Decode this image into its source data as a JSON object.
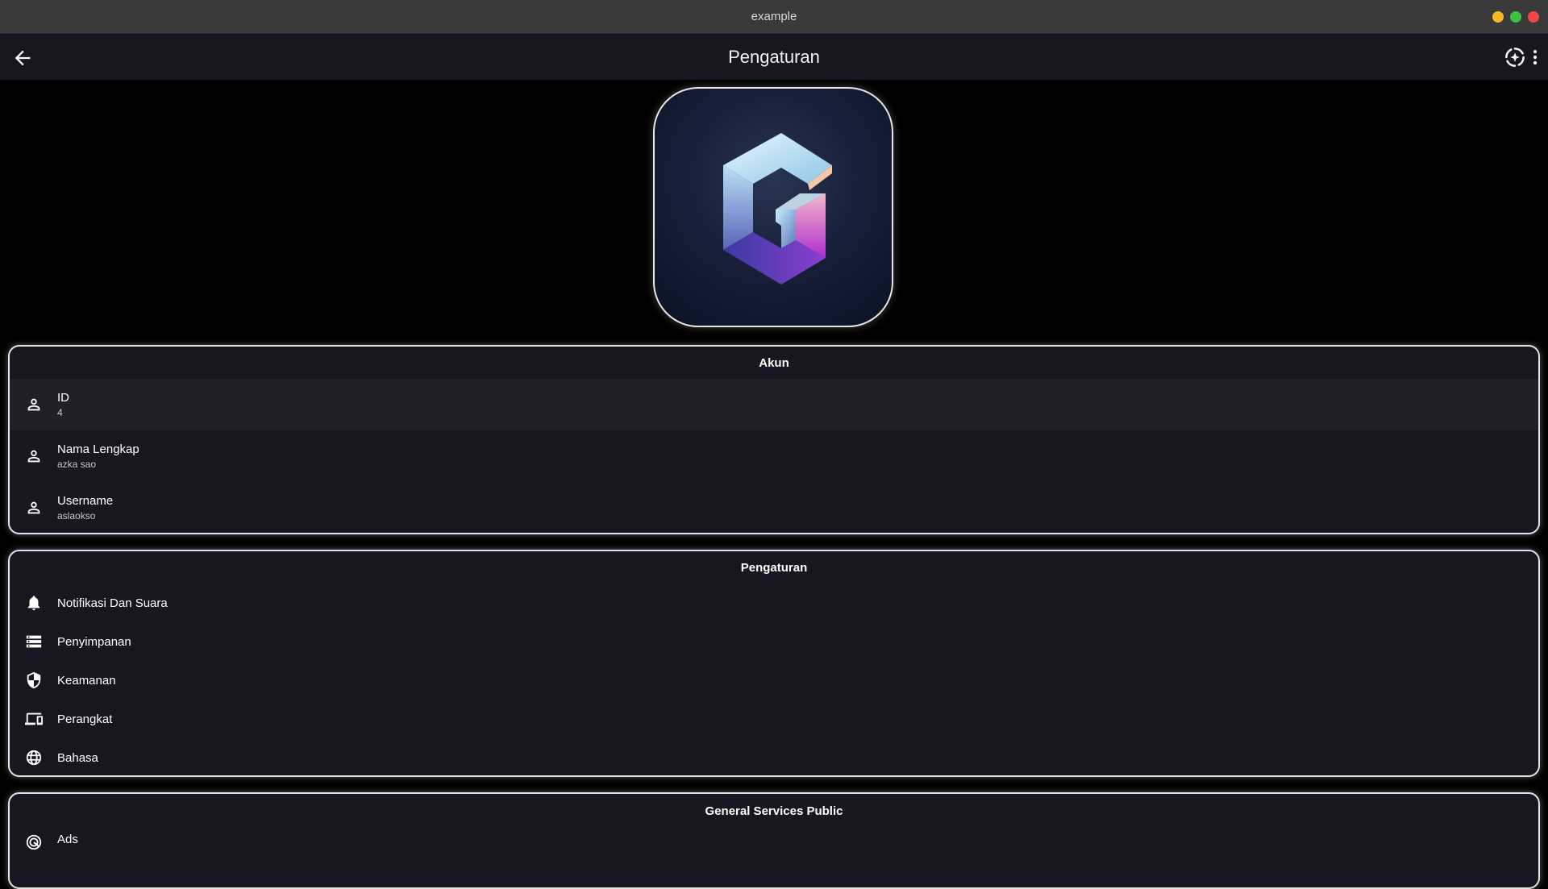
{
  "window": {
    "title": "example"
  },
  "appbar": {
    "title": "Pengaturan"
  },
  "account": {
    "title": "Akun",
    "items": [
      {
        "label": "ID",
        "value": "4",
        "icon": "person-icon"
      },
      {
        "label": "Nama Lengkap",
        "value": "azka sao",
        "icon": "person-icon"
      },
      {
        "label": "Username",
        "value": "aslaokso",
        "icon": "person-icon"
      }
    ]
  },
  "settings": {
    "title": "Pengaturan",
    "items": [
      {
        "label": "Notifikasi Dan Suara",
        "icon": "bell-icon"
      },
      {
        "label": "Penyimpanan",
        "icon": "storage-icon"
      },
      {
        "label": "Keamanan",
        "icon": "shield-icon"
      },
      {
        "label": "Perangkat",
        "icon": "devices-icon"
      },
      {
        "label": "Bahasa",
        "icon": "globe-icon"
      }
    ]
  },
  "public_services": {
    "title": "General Services Public",
    "items": [
      {
        "label": "Ads",
        "icon": "ads-icon"
      }
    ]
  },
  "colors": {
    "background": "#000000",
    "appbar": "#161720",
    "card": "#161720",
    "card_border": "#e2e2e2",
    "highlight_row": "#1f2029"
  }
}
